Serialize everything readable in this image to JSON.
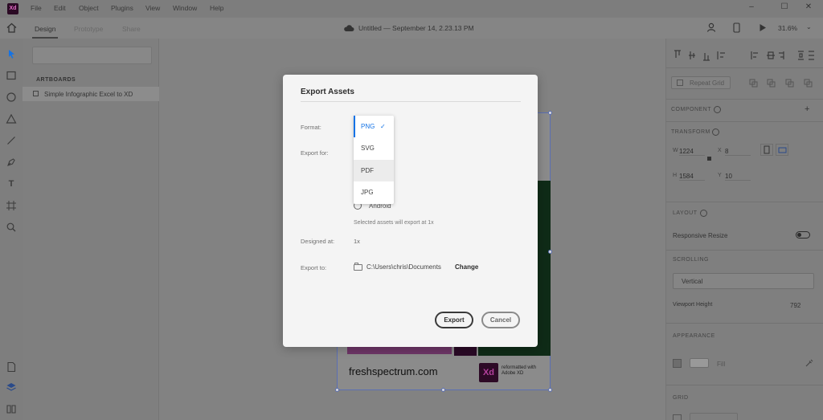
{
  "app": {
    "logo_text": "Xd"
  },
  "menu": [
    "File",
    "Edit",
    "Object",
    "Plugins",
    "View",
    "Window",
    "Help"
  ],
  "tabs": [
    "Design",
    "Prototype",
    "Share"
  ],
  "document_title": "Untitled — September 14, 2.23.13 PM",
  "zoom_level": "31.6%",
  "layers": {
    "section_label": "ARTBOARDS",
    "artboards": [
      "Simple Infographic Excel to XD"
    ]
  },
  "artboard": {
    "site_text": "freshspectrum.com",
    "logo_text": "Xd",
    "reformat_text": "reformatted with Adobe XD"
  },
  "right_panel": {
    "repeat_grid": "Repeat Grid",
    "component_label": "COMPONENT",
    "transform_label": "TRANSFORM",
    "w_label": "W",
    "w_value": "1224",
    "x_label": "X",
    "x_value": "8",
    "h_label": "H",
    "h_value": "1584",
    "y_label": "Y",
    "y_value": "10",
    "layout_label": "LAYOUT",
    "responsive_resize": "Responsive Resize",
    "scrolling_label": "SCROLLING",
    "scrolling_value": "Vertical",
    "viewport_height_label": "Viewport Height",
    "viewport_height_value": "792",
    "appearance_label": "APPEARANCE",
    "fill_label": "Fill",
    "grid_label": "GRID"
  },
  "modal": {
    "title": "Export Assets",
    "format_label": "Format:",
    "export_for_label": "Export for:",
    "android_label": "Android",
    "hint": "Selected assets will export at 1x",
    "designed_at_label": "Designed at:",
    "designed_at_value": "1x",
    "export_to_label": "Export to:",
    "export_path": "C:\\Users\\chris\\Documents",
    "change_label": "Change",
    "export_button": "Export",
    "cancel_button": "Cancel",
    "format_options": [
      "PNG",
      "SVG",
      "PDF",
      "JPG"
    ],
    "selected_format": "PNG"
  },
  "colors": {
    "accent": "#1473e6",
    "xd_brand": "#2d0a26"
  }
}
